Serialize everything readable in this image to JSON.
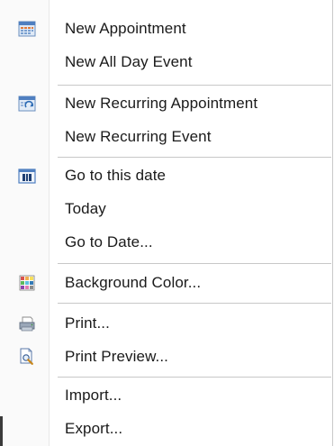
{
  "menu": {
    "items": [
      {
        "label": "New Appointment",
        "icon": "calendar-icon"
      },
      {
        "label": "New All Day Event",
        "icon": ""
      },
      {
        "label": "New Recurring Appointment",
        "icon": "recurring-calendar-icon"
      },
      {
        "label": "New Recurring Event",
        "icon": ""
      },
      {
        "label": "Go to this date",
        "icon": "go-to-date-icon"
      },
      {
        "label": "Today",
        "icon": ""
      },
      {
        "label": "Go to Date...",
        "icon": ""
      },
      {
        "label": "Background Color...",
        "icon": "color-grid-icon"
      },
      {
        "label": "Print...",
        "icon": "printer-icon"
      },
      {
        "label": "Print Preview...",
        "icon": "print-preview-icon"
      },
      {
        "label": "Import...",
        "icon": ""
      },
      {
        "label": "Export...",
        "icon": ""
      }
    ]
  },
  "colors": {
    "separator": "#c8c8c8",
    "gutter": "#fafafa",
    "text": "#1a1a1a"
  }
}
